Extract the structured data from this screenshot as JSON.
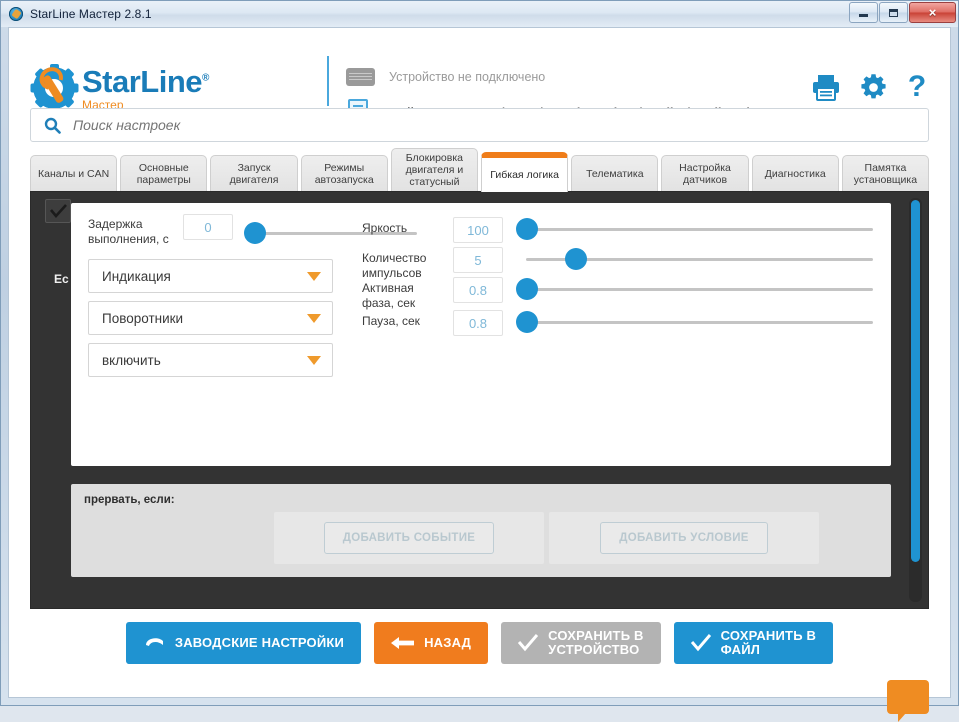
{
  "window": {
    "title": "StarLine Мастер 2.8.1",
    "app_icon": "gear-wrench-icon",
    "controls": {
      "minimize": "minimize-icon",
      "maximize": "maximize-icon",
      "close": "×"
    }
  },
  "header": {
    "logo": {
      "name": "StarLine",
      "trademark": "®",
      "subtitle": "Мастер",
      "icon": "gear-wrench-logo"
    },
    "device_status": "Устройство не подключено",
    "settings_file": "Файл настроек: C:\\Users\\GLogi...Desktop\\starline\\starline.slc",
    "icons": [
      {
        "name": "print-icon",
        "glyph": "printer"
      },
      {
        "name": "settings-gear-icon",
        "glyph": "gear"
      },
      {
        "name": "help-icon",
        "glyph": "?"
      }
    ]
  },
  "search": {
    "placeholder": "Поиск настроек",
    "value": "",
    "icon": "search-icon"
  },
  "tabs": [
    {
      "label": "Каналы и CAN",
      "active": false,
      "tall": false
    },
    {
      "label": "Основные параметры",
      "active": false,
      "tall": false
    },
    {
      "label": "Запуск двигателя",
      "active": false,
      "tall": false
    },
    {
      "label": "Режимы автозапуска",
      "active": false,
      "tall": false
    },
    {
      "label": "Блокировка двигателя и статусный выход",
      "active": false,
      "tall": true
    },
    {
      "label": "Гибкая логика",
      "active": true,
      "tall": false
    },
    {
      "label": "Телематика",
      "active": false,
      "tall": false
    },
    {
      "label": "Настройка датчиков",
      "active": false,
      "tall": false
    },
    {
      "label": "Диагностика",
      "active": false,
      "tall": false
    },
    {
      "label": "Памятка установщика",
      "active": false,
      "tall": false
    }
  ],
  "editor": {
    "enable_checkbox": {
      "checked": true,
      "icon": "check-icon"
    },
    "condition_label": "Ес",
    "delay": {
      "label": "Задержка выполнения, с",
      "value": "0"
    },
    "dropdowns": [
      {
        "name": "action-type",
        "value": "Индикация"
      },
      {
        "name": "action-target",
        "value": "Поворотники"
      },
      {
        "name": "action-state",
        "value": "включить"
      }
    ],
    "params": [
      {
        "label": "Яркость",
        "value": "100",
        "knob_pct": 0
      },
      {
        "label": "Количество импульсов",
        "value": "5",
        "knob_pct": 14
      },
      {
        "label": "Активная фаза, сек",
        "value": "0.8",
        "knob_pct": 0
      },
      {
        "label": "Пауза, сек",
        "value": "0.8",
        "knob_pct": 0
      }
    ],
    "abort": {
      "title": "прервать, если:",
      "add_event": "ДОБАВИТЬ СОБЫТИЕ",
      "add_condition": "ДОБАВИТЬ УСЛОВИЕ"
    }
  },
  "footer": {
    "factory": {
      "label": "ЗАВОДСКИЕ НАСТРОЙКИ",
      "icon": "restore-icon",
      "color": "#1f93d1"
    },
    "back": {
      "label": "НАЗАД",
      "icon": "arrow-left-icon",
      "color": "#f07c1e"
    },
    "save_device": {
      "line1": "СОХРАНИТЬ В",
      "line2": "УСТРОЙСТВО",
      "icon": "check-icon",
      "color": "#b3b3b3"
    },
    "save_file": {
      "line1": "СОХРАНИТЬ В",
      "line2": "ФАЙЛ",
      "icon": "check-icon",
      "color": "#1f93d1"
    }
  },
  "chat_button": {
    "name": "chat-bubble-icon",
    "color": "#ef8c22"
  }
}
